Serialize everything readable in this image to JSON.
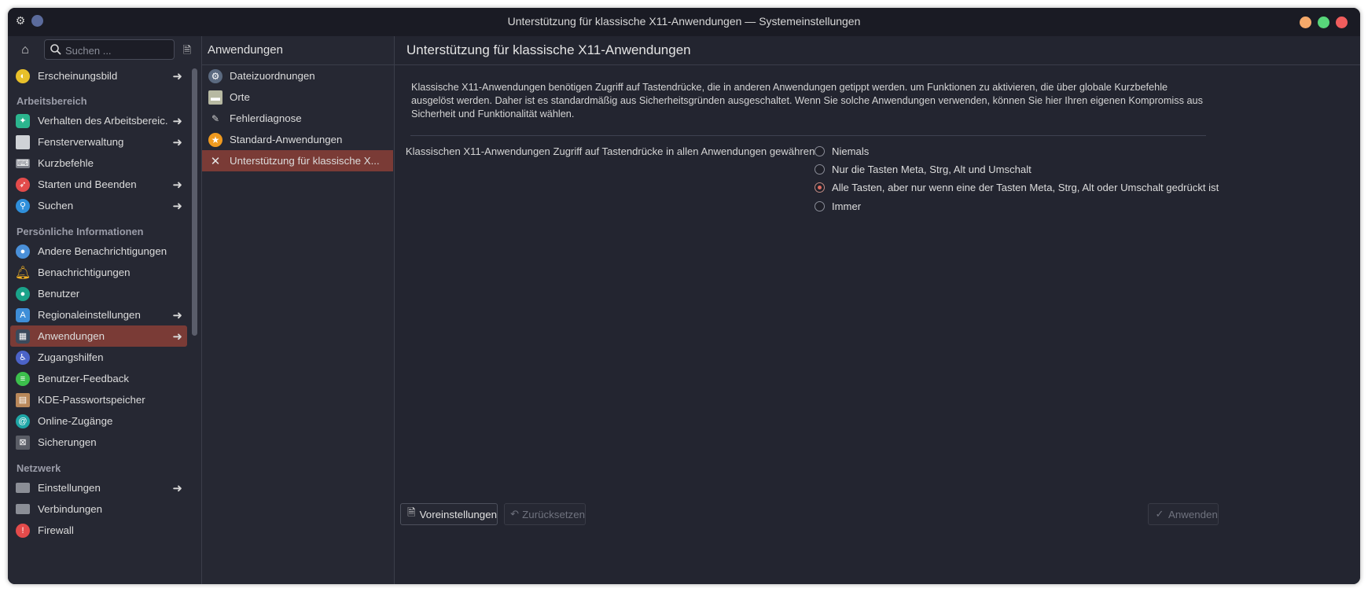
{
  "window": {
    "title": "Unterstützung für klassische X11-Anwendungen — Systemeinstellungen",
    "menu_icon": "gear-icon",
    "buttons": [
      {
        "name": "minimize",
        "color": "#f5a96a"
      },
      {
        "name": "maximize",
        "color": "#58d67a"
      },
      {
        "name": "close",
        "color": "#f05d5d"
      }
    ]
  },
  "sidebar": {
    "search_placeholder": "Suchen ...",
    "sections": [
      {
        "label": "Arbeitsbereich"
      },
      {
        "label": "Persönliche Informationen"
      },
      {
        "label": "Netzwerk"
      }
    ],
    "items": [
      {
        "label": "Erscheinungsbild",
        "icon": "appearance-icon",
        "color": "#e8c02a",
        "arrow": true
      },
      {
        "label": "Verhalten des Arbeitsbereic...",
        "icon": "workspace-behavior-icon",
        "color": "#2bb58e",
        "arrow": true
      },
      {
        "label": "Fensterverwaltung",
        "icon": "window-management-icon",
        "color": "#cfd2d6",
        "arrow": true
      },
      {
        "label": "Kurzbefehle",
        "icon": "keyboard-icon",
        "color": "#7c7f88",
        "arrow": false
      },
      {
        "label": "Starten und Beenden",
        "icon": "rocket-icon",
        "color": "#e34b4b",
        "arrow": true
      },
      {
        "label": "Suchen",
        "icon": "search-icon",
        "color": "#2f8fdb",
        "arrow": true
      },
      {
        "label": "Andere Benachrichtigungen",
        "icon": "other-notifications-icon",
        "color": "#4a90d9",
        "arrow": false
      },
      {
        "label": "Benachrichtigungen",
        "icon": "bell-icon",
        "color": "#f4b323",
        "arrow": false
      },
      {
        "label": "Benutzer",
        "icon": "user-icon",
        "color": "#1aa38a",
        "arrow": false
      },
      {
        "label": "Regionaleinstellungen",
        "icon": "region-icon",
        "color": "#3e8ed8",
        "arrow": true
      },
      {
        "label": "Anwendungen",
        "icon": "applications-icon",
        "color": "#3a4a5c",
        "arrow": true,
        "selected": true
      },
      {
        "label": "Zugangshilfen",
        "icon": "accessibility-icon",
        "color": "#4b63c8",
        "arrow": false
      },
      {
        "label": "Benutzer-Feedback",
        "icon": "feedback-icon",
        "color": "#3cbf4c",
        "arrow": false
      },
      {
        "label": "KDE-Passwortspeicher",
        "icon": "wallet-icon",
        "color": "#b9885a",
        "arrow": false
      },
      {
        "label": "Online-Zugänge",
        "icon": "online-accounts-icon",
        "color": "#1ea6a6",
        "arrow": false
      },
      {
        "label": "Sicherungen",
        "icon": "backup-icon",
        "color": "#5a5d66",
        "arrow": false
      },
      {
        "label": "Einstellungen",
        "icon": "network-settings-icon",
        "color": "#8b8e96",
        "arrow": true
      },
      {
        "label": "Verbindungen",
        "icon": "connections-icon",
        "color": "#8b8e96",
        "arrow": false
      },
      {
        "label": "Firewall",
        "icon": "firewall-icon",
        "color": "#e34b4b",
        "arrow": false
      }
    ]
  },
  "subpanel": {
    "title": "Anwendungen",
    "items": [
      {
        "label": "Dateizuordnungen",
        "icon": "file-associations-icon",
        "color": "#5b6a80"
      },
      {
        "label": "Orte",
        "icon": "places-icon",
        "color": "#b7b9a2"
      },
      {
        "label": "Fehlerdiagnose",
        "icon": "crash-handler-icon",
        "color": "#6b6e78"
      },
      {
        "label": "Standard-Anwendungen",
        "icon": "star-icon",
        "color": "#f09a1f"
      },
      {
        "label": "Unterstützung für klassische X...",
        "icon": "x11-icon",
        "color": "#c6c8d0",
        "selected": true
      }
    ]
  },
  "content": {
    "title": "Unterstützung für klassische X11-Anwendungen",
    "description": "Klassische X11-Anwendungen benötigen Zugriff auf Tastendrücke, die in anderen Anwendungen getippt werden. um Funktionen zu aktivieren, die über globale Kurzbefehle ausgelöst werden. Daher ist es standardmäßig aus Sicherheitsgründen ausgeschaltet. Wenn Sie solche Anwendungen verwenden, können Sie hier Ihren eigenen Kompromiss aus Sicherheit und Funktionalität wählen.",
    "option_label": "Klassischen X11-Anwendungen Zugriff auf Tastendrücke in allen Anwendungen gewähren:",
    "options": [
      {
        "label": "Niemals",
        "checked": false
      },
      {
        "label": "Nur die Tasten Meta, Strg, Alt und Umschalt",
        "checked": false
      },
      {
        "label": "Alle Tasten, aber nur wenn eine der Tasten Meta, Strg, Alt oder Umschalt gedrückt ist",
        "checked": true
      },
      {
        "label": "Immer",
        "checked": false
      }
    ]
  },
  "footer": {
    "defaults_label": "Voreinstellungen",
    "reset_label": "Zurücksetzen",
    "apply_label": "Anwenden"
  }
}
